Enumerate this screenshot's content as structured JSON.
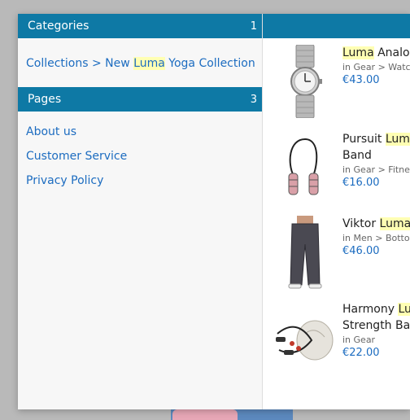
{
  "categories": {
    "title": "Categories",
    "count": "1",
    "items": [
      {
        "pre": "Collections > New ",
        "highlight": "Luma",
        "post": " Yoga Collection"
      }
    ]
  },
  "pages": {
    "title": "Pages",
    "count": "3",
    "items": [
      "About us",
      "Customer Service",
      "Privacy Policy"
    ]
  },
  "products": [
    {
      "name_highlight": "Luma",
      "name_rest": " Analog",
      "name_line2": "",
      "category": "in Gear > Watch",
      "price": "€43.00"
    },
    {
      "name_pre": "Pursuit ",
      "name_highlight": "Lum",
      "name_line2": "Band",
      "category": "in Gear > Fitness",
      "price": "€16.00"
    },
    {
      "name_pre": "Viktor ",
      "name_highlight": "Luma",
      "name_line2": "",
      "category": "in Men > Botton",
      "price": "€46.00"
    },
    {
      "name_pre": "Harmony ",
      "name_highlight": "Lu",
      "name_line2": "Strength Ban",
      "category": "in Gear",
      "price": "€22.00"
    }
  ],
  "colors": {
    "header": "#0e79a5",
    "link": "#1c6cc0",
    "highlight": "#ffffb3"
  }
}
